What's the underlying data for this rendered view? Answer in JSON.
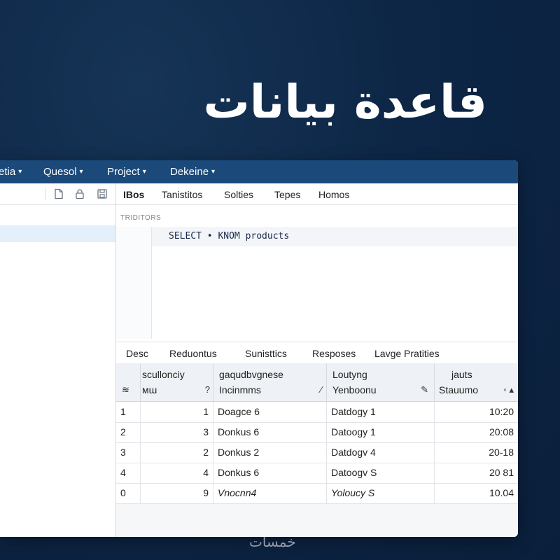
{
  "headline": "قاعدة بيانات",
  "watermark": "خمسات",
  "menu": [
    {
      "label": "etia",
      "caret": "▾"
    },
    {
      "label": "Quesol",
      "caret": "▾"
    },
    {
      "label": "Project",
      "caret": "▾"
    },
    {
      "label": "Dekeine",
      "caret": "▾"
    }
  ],
  "top_tabs": [
    "IBos",
    "Tanistitos",
    "Solties",
    "Tepes",
    "Homos"
  ],
  "editor": {
    "label": "TRIDITORS",
    "query": "SELECT • KNOM products"
  },
  "bottom_tabs": [
    "Desc",
    "Reduontus",
    "Sunisttics",
    "Resposes",
    "Lavge Pratities"
  ],
  "grid": {
    "headers": [
      {
        "line1": "",
        "line2": "",
        "icon": "≋"
      },
      {
        "line1": "scullonciy",
        "line2": "мɯ",
        "icon": "?"
      },
      {
        "line1": "gaqudbvgnese",
        "line2": "Incinmms",
        "icon": "∕"
      },
      {
        "line1": "Loutyng",
        "line2": "Yenboonu",
        "icon": "✎"
      },
      {
        "line1": "jauts",
        "line2": "Stauumo",
        "icon": "◦ ▴"
      }
    ],
    "rows": [
      [
        "1",
        "1",
        "Doagce 6",
        "Datdogy 1",
        "10:20"
      ],
      [
        "2",
        "3",
        "Donkus 6",
        "Datoogy 1",
        "20:08"
      ],
      [
        "3",
        "2",
        "Donkus 2",
        "Datdogv 4",
        "20-18"
      ],
      [
        "4",
        "4",
        "Donkus 6",
        "Datoogv S",
        "20 81"
      ],
      [
        "0",
        "9",
        "Vnocnn4",
        "Yoloucy S",
        "10.04"
      ]
    ]
  },
  "colors": {
    "background": "#0d2646",
    "menubar": "#1b4a7a",
    "selected_row": "#e3effa"
  }
}
